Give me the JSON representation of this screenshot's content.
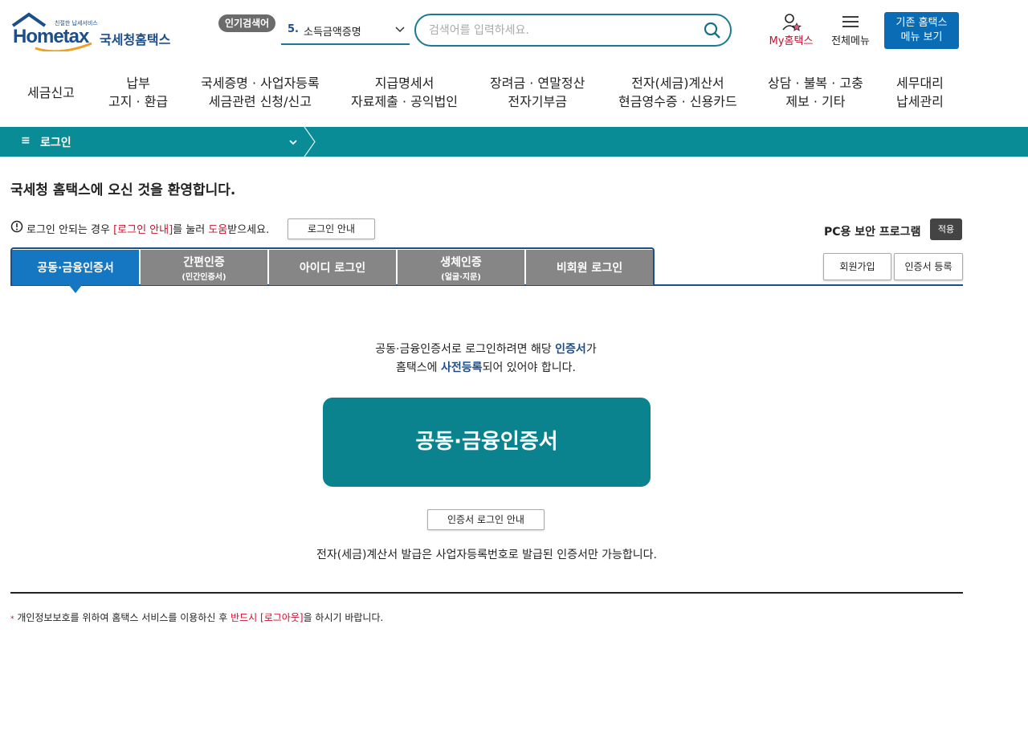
{
  "header": {
    "logo_tagline": "친절한 납세서비스",
    "logo_word": "Hometax",
    "logo_name": "국세청홈택스",
    "popular_badge": "인기검색어",
    "popular_rank": "5.",
    "popular_term": "소득금액증명",
    "search_placeholder": "검색어를 입력하세요.",
    "my_hometax": "My홈택스",
    "all_menu": "전체메뉴",
    "old_menu_line1": "기존 홈택스",
    "old_menu_line2": "메뉴 보기"
  },
  "gnb": {
    "items": [
      {
        "line1": "세금신고",
        "line2": ""
      },
      {
        "line1": "납부",
        "line2": "고지 · 환급"
      },
      {
        "line1": "국세증명 · 사업자등록",
        "line2": "세금관련 신청/신고"
      },
      {
        "line1": "지급명세서",
        "line2": "자료제출 · 공익법인"
      },
      {
        "line1": "장려금 · 연말정산",
        "line2": "전자기부금"
      },
      {
        "line1": "전자(세금)계산서",
        "line2": "현금영수증 · 신용카드"
      },
      {
        "line1": "상담 · 불복 · 고충",
        "line2": "제보 · 기타"
      },
      {
        "line1": "세무대리",
        "line2": "납세관리"
      }
    ]
  },
  "location": {
    "menu_glyph": "≡",
    "current": "로그인"
  },
  "main": {
    "welcome": "국세청 홈택스에 오신 것을 환영합니다.",
    "help_prefix": "로그인 안되는 경우 ",
    "help_link": "[로그인 안내]",
    "help_mid": "를 눌러 ",
    "help_help": "도움",
    "help_suffix": "받으세요.",
    "login_guide_button": "로그인 안내",
    "security_label": "PC용 보안 프로그램",
    "security_button": "적용",
    "tabs": [
      {
        "label": "공동·금융인증서",
        "sub": ""
      },
      {
        "label": "간편인증",
        "sub": "(민간인증서)"
      },
      {
        "label": "아이디 로그인",
        "sub": ""
      },
      {
        "label": "생체인증",
        "sub": "(얼굴·지문)"
      },
      {
        "label": "비회원 로그인",
        "sub": ""
      }
    ],
    "join_button": "회원가입",
    "cert_register_button": "인증서 등록",
    "info_line1_a": "공동·금융인증서로 로그인하려면 해당 ",
    "info_line1_b": "인증서",
    "info_line1_c": "가",
    "info_line2_a": "홈택스에 ",
    "info_line2_b": "사전등록",
    "info_line2_c": "되어 있어야 합니다.",
    "big_button": "공동·금융인증서",
    "cert_guide_button": "인증서 로그인 안내",
    "note": "전자(세금)계산서 발급은 사업자등록번호로 발급된 인증서만 가능합니다."
  },
  "footer": {
    "bullet": "*",
    "note_a": " 개인정보보호를 위하여 홈택스 서비스를 이용하신 후 ",
    "note_red": "반드시 [로그아웃]",
    "note_b": "을 하시기 바랍니다."
  },
  "colors": {
    "teal": "#0a8c96",
    "navy": "#1c4e8c",
    "tab_active": "#1576c2",
    "tab_inactive": "#868686",
    "accent_red": "#c8102e"
  }
}
